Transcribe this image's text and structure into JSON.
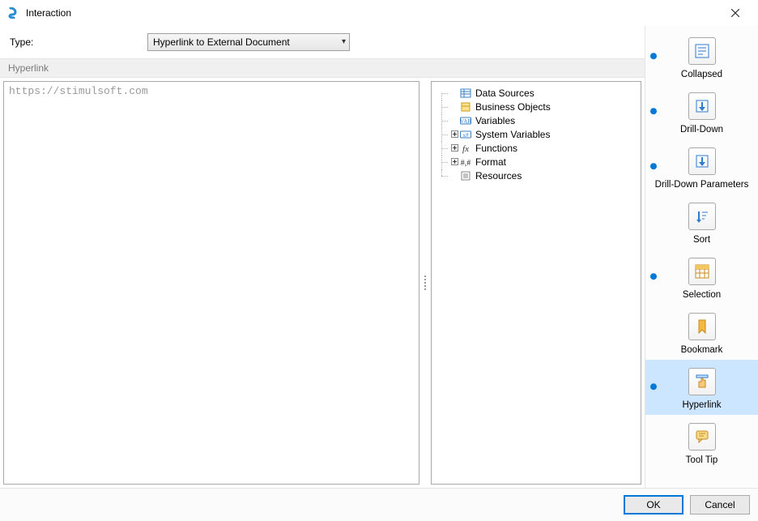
{
  "window": {
    "title": "Interaction",
    "close_tooltip": "Close"
  },
  "type": {
    "label": "Type:",
    "value": "Hyperlink to External Document"
  },
  "section": {
    "title": "Hyperlink"
  },
  "editor": {
    "text": "https://stimulsoft.com"
  },
  "tree": {
    "items": [
      {
        "label": "Data Sources",
        "icon": "datasource-icon",
        "expandable": false
      },
      {
        "label": "Business Objects",
        "icon": "bizobject-icon",
        "expandable": false
      },
      {
        "label": "Variables",
        "icon": "variable-icon",
        "expandable": false
      },
      {
        "label": "System Variables",
        "icon": "sysvariable-icon",
        "expandable": true
      },
      {
        "label": "Functions",
        "icon": "function-icon",
        "expandable": true
      },
      {
        "label": "Format",
        "icon": "format-icon",
        "expandable": true
      },
      {
        "label": "Resources",
        "icon": "resources-icon",
        "expandable": false
      }
    ]
  },
  "categories": [
    {
      "label": "Collapsed",
      "icon": "collapsed-icon",
      "indicator": true,
      "selected": false
    },
    {
      "label": "Drill-Down",
      "icon": "drilldown-icon",
      "indicator": true,
      "selected": false
    },
    {
      "label": "Drill-Down Parameters",
      "icon": "drillparams-icon",
      "indicator": true,
      "selected": false
    },
    {
      "label": "Sort",
      "icon": "sort-icon",
      "indicator": false,
      "selected": false
    },
    {
      "label": "Selection",
      "icon": "selection-icon",
      "indicator": true,
      "selected": false
    },
    {
      "label": "Bookmark",
      "icon": "bookmark-icon",
      "indicator": false,
      "selected": false
    },
    {
      "label": "Hyperlink",
      "icon": "hyperlink-icon",
      "indicator": true,
      "selected": true
    },
    {
      "label": "Tool Tip",
      "icon": "tooltip-icon",
      "indicator": false,
      "selected": false
    }
  ],
  "footer": {
    "ok": "OK",
    "cancel": "Cancel"
  },
  "icons": {
    "collapsed": "list-collapse",
    "drilldown": "arrow-down-box",
    "drillparams": "arrow-down-box",
    "sort": "sort-lines",
    "selection": "table-grid",
    "bookmark": "bookmark",
    "hyperlink": "hand-pointer",
    "tooltip": "speech-bubble"
  }
}
